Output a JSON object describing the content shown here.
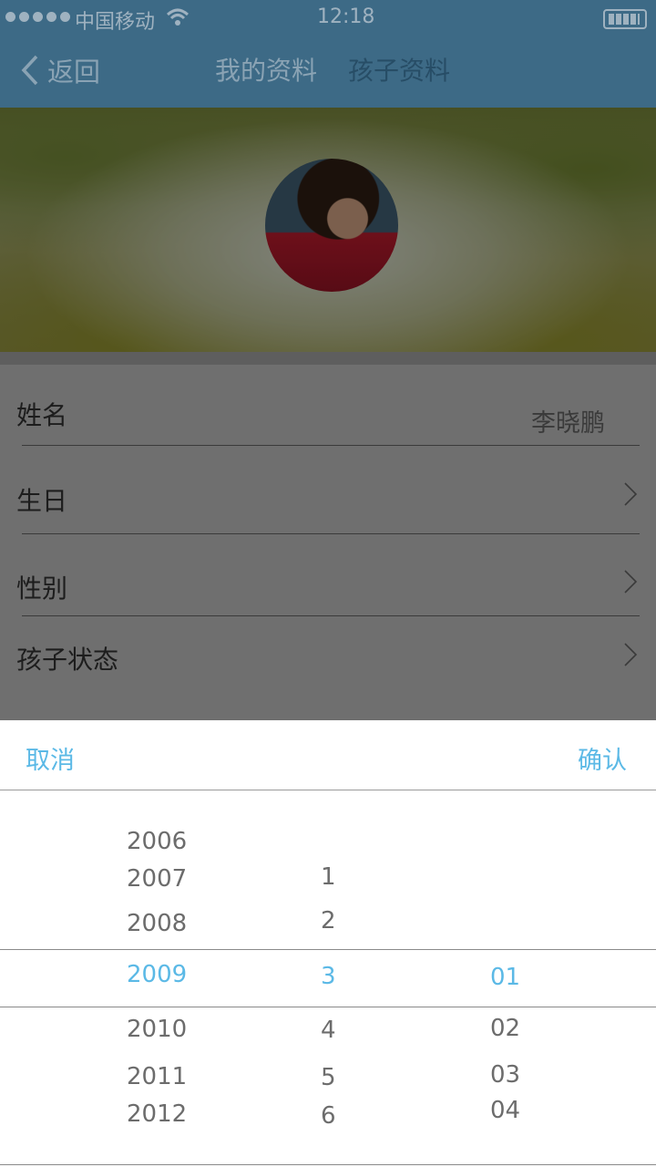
{
  "status_bar": {
    "carrier": "中国移动",
    "time": "12:18"
  },
  "nav": {
    "back_label": "返回",
    "tabs": [
      "我的资料",
      "孩子资料"
    ],
    "active_tab": 1
  },
  "form": {
    "rows": [
      {
        "label": "姓名",
        "value": "李晓鹏"
      },
      {
        "label": "生日"
      },
      {
        "label": "性别"
      },
      {
        "label": "孩子状态"
      }
    ]
  },
  "picker": {
    "cancel_label": "取消",
    "confirm_label": "确认",
    "years": [
      "2006",
      "2007",
      "2008",
      "2009",
      "2010",
      "2011",
      "2012"
    ],
    "months": [
      "1",
      "2",
      "3",
      "4",
      "5",
      "6"
    ],
    "days": [
      "01",
      "02",
      "03",
      "04"
    ],
    "selected": {
      "year": "2009",
      "month": "3",
      "day": "01"
    }
  },
  "colors": {
    "nav": "#3d6a86",
    "accent": "#5bb9e6",
    "overlay_gray": "#6f6f6f"
  }
}
